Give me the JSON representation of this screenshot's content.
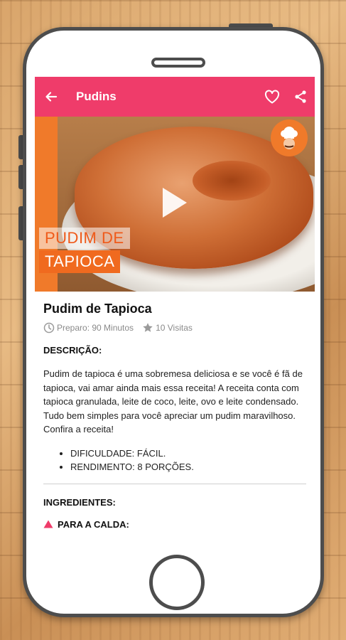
{
  "appbar": {
    "title": "Pudins",
    "back_icon": "arrow-left-icon",
    "favorite_icon": "heart-outline-icon",
    "share_icon": "share-icon",
    "color": "#ef3c6a"
  },
  "hero": {
    "caption_line1": "PUDIM DE",
    "caption_line2": "TAPIOCA",
    "play_icon": "play-icon",
    "chef_logo": "chef-logo-icon"
  },
  "recipe": {
    "title": "Pudim de Tapioca",
    "prep": "Preparo: 90 Minutos",
    "visits": "10 Visitas",
    "description_heading": "DESCRIÇÃO:",
    "description": "Pudim de tapioca é uma sobremesa deliciosa e se você é fã de tapioca, vai amar ainda mais essa receita! A receita conta com tapioca granulada, leite de coco, leite, ovo e leite condensado. Tudo bem simples para você apreciar um pudim maravilhoso. Confira a receita!",
    "facts": [
      "DIFICULDADE: FÁCIL.",
      "RENDIMENTO: 8 PORÇÕES."
    ],
    "ingredients_heading": "INGREDIENTES:",
    "sub_heading": "PARA A CALDA:"
  }
}
